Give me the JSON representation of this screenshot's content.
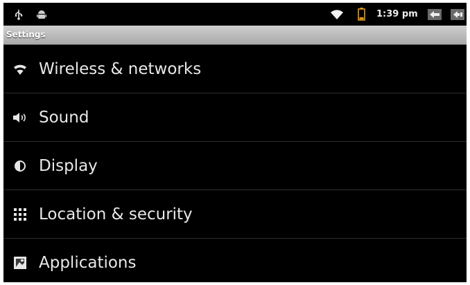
{
  "status_bar": {
    "time": "1:39 pm",
    "icons": [
      "usb-icon",
      "android-icon",
      "wifi-signal-icon",
      "battery-icon",
      "back-key-icon",
      "menu-key-icon"
    ]
  },
  "title_bar": {
    "title": "Settings"
  },
  "settings_list": [
    {
      "label": "Wireless & networks",
      "icon": "wifi-icon"
    },
    {
      "label": "Sound",
      "icon": "speaker-icon"
    },
    {
      "label": "Display",
      "icon": "brightness-icon"
    },
    {
      "label": "Location & security",
      "icon": "grid-icon"
    },
    {
      "label": "Applications",
      "icon": "applications-icon"
    }
  ],
  "colors": {
    "background": "#000000",
    "title_bar": "#b8b8b8",
    "text": "#e8e8e8",
    "battery": "#e39a1a"
  }
}
